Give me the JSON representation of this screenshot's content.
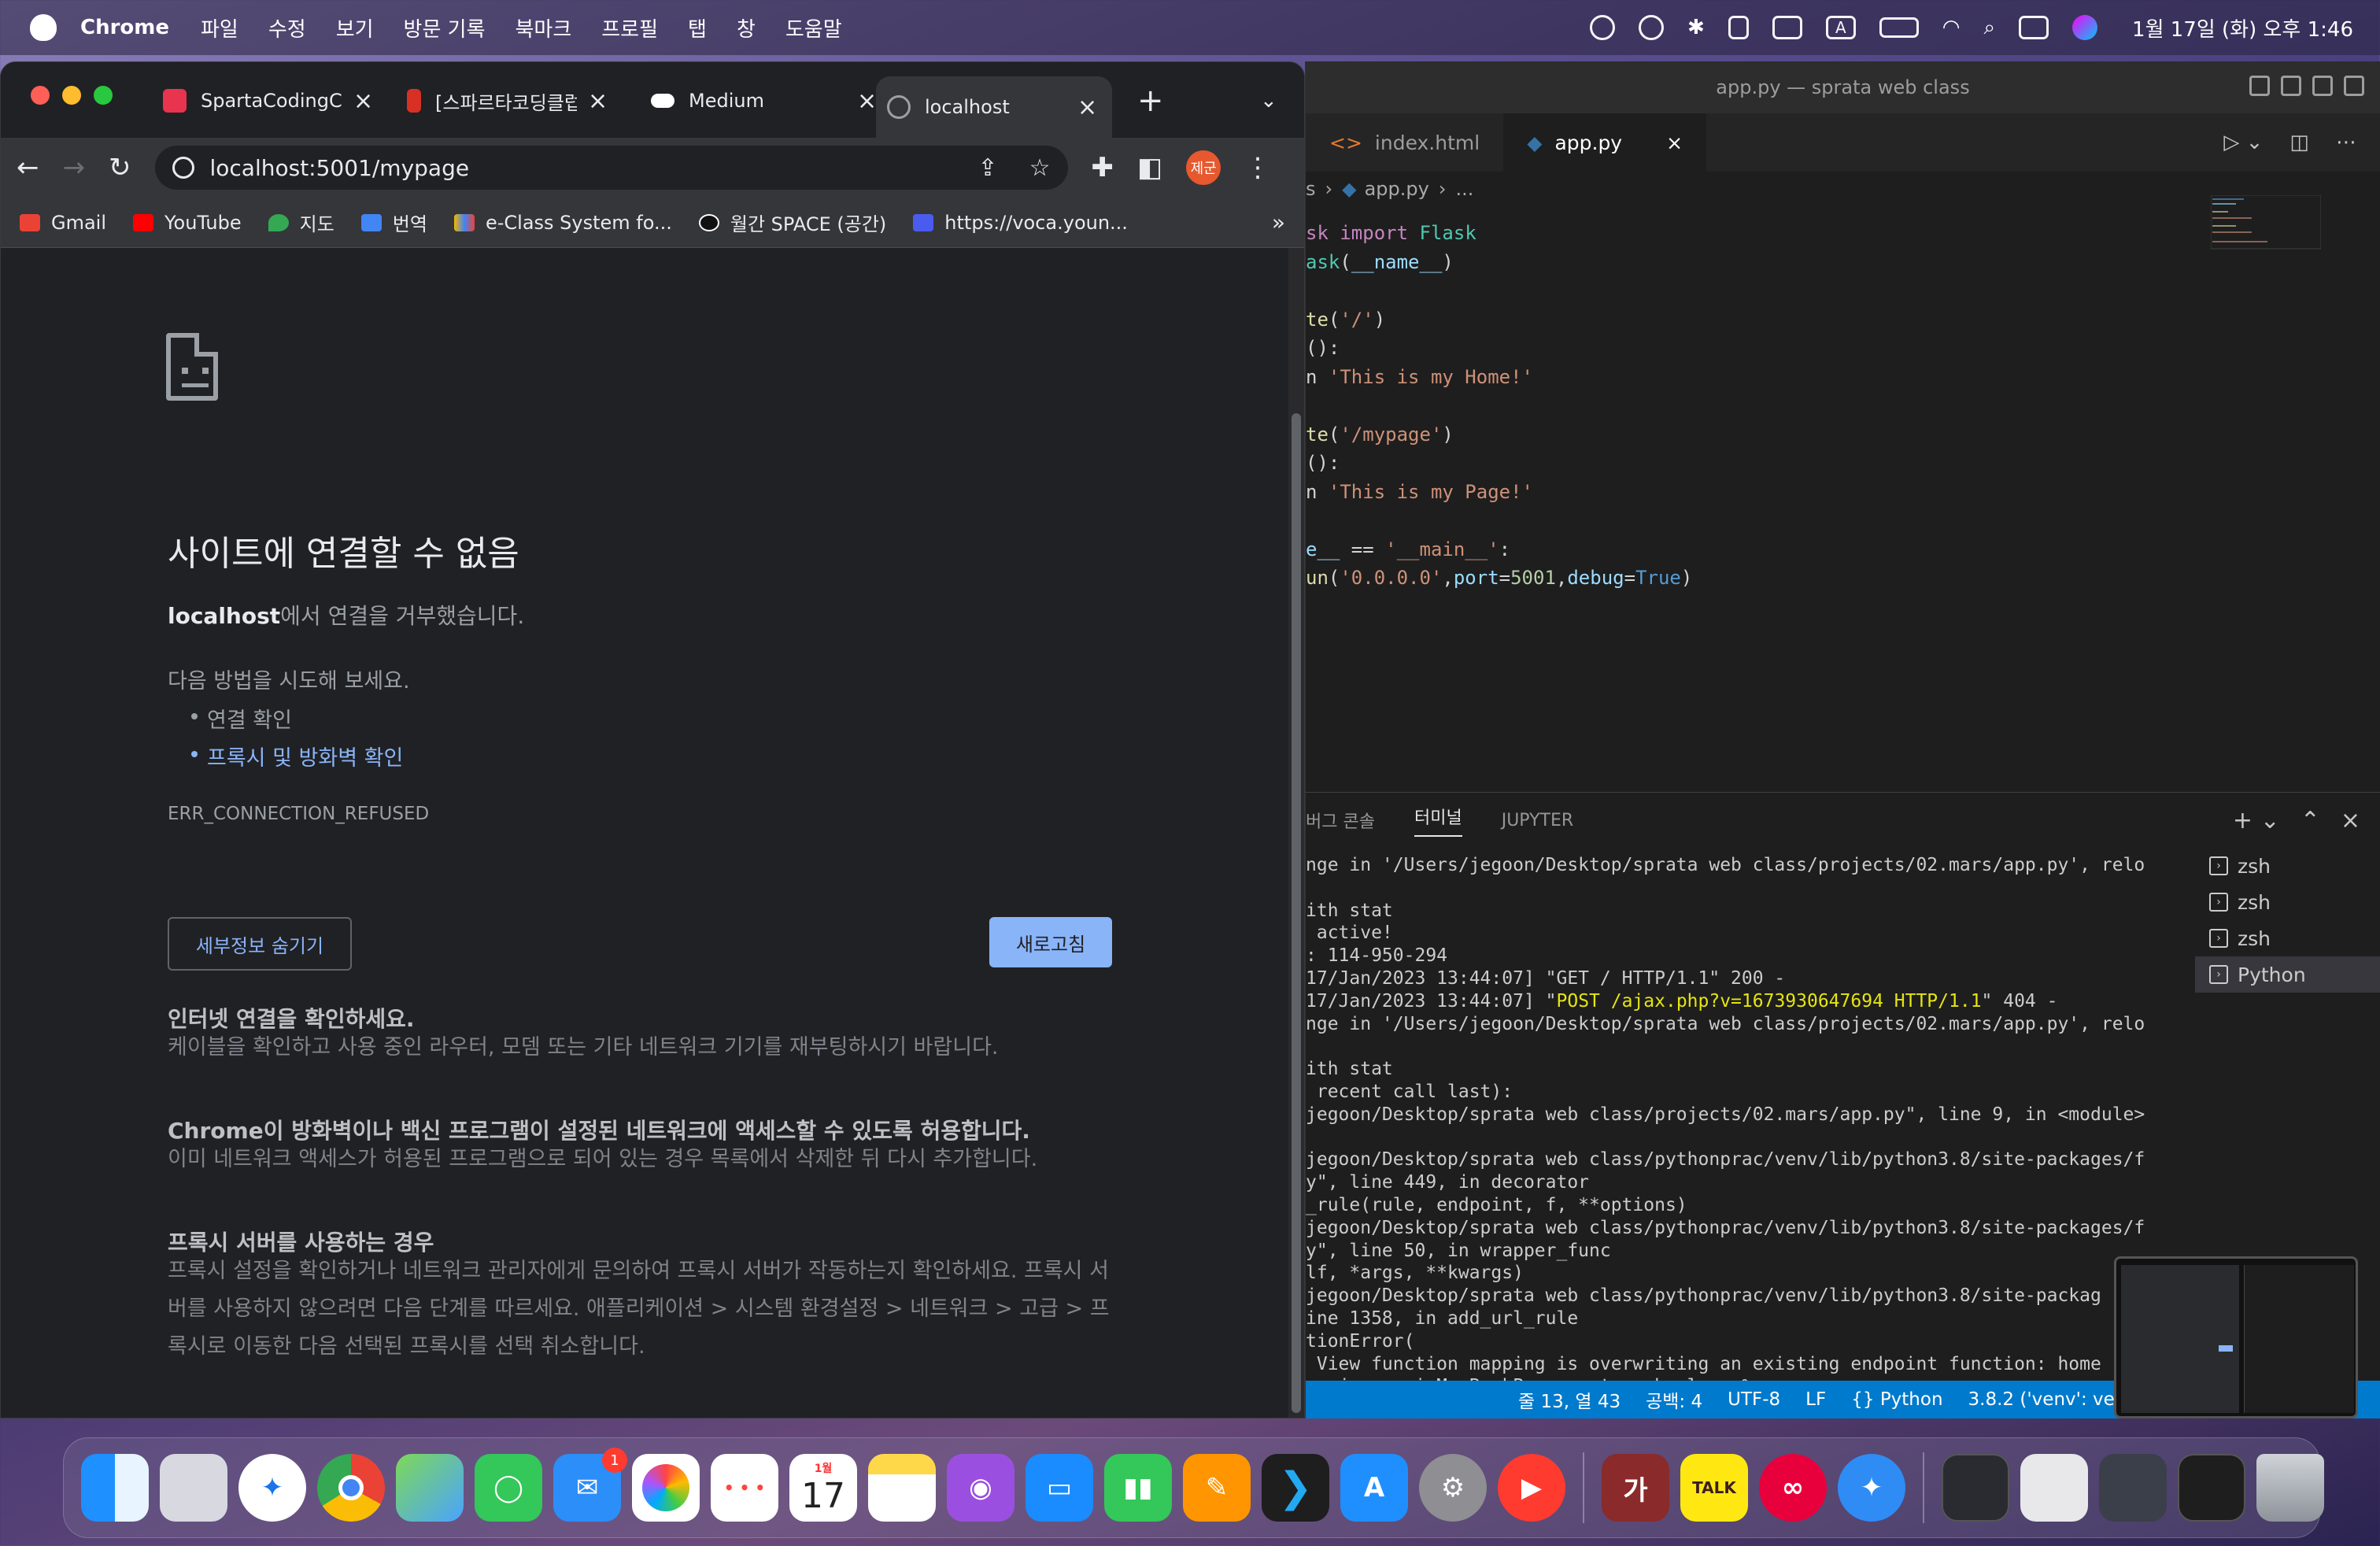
{
  "menubar": {
    "app_name": "Chrome",
    "menus": [
      "파일",
      "수정",
      "보기",
      "방문 기록",
      "북마크",
      "프로필",
      "탭",
      "창",
      "도움말"
    ],
    "clock": "1월 17일 (화) 오후 1:46",
    "status_icons": [
      "wechat-icon",
      "cloud-sync-icon",
      "bluetooth-icon",
      "id-icon",
      "display-icon",
      "input-source-icon",
      "battery-icon",
      "wifi-icon",
      "spotlight-icon",
      "control-center-icon",
      "siri-icon"
    ],
    "input_source": "A"
  },
  "chrome": {
    "tabs": [
      {
        "title": "SpartaCodingClub",
        "favicon_color": "#e8344e"
      },
      {
        "title": "[스파르타코딩클럽]",
        "favicon_color": "#d93025"
      },
      {
        "title": "Medium",
        "favicon_color": "#000000"
      },
      {
        "title": "localhost",
        "favicon_color": "#5f6368",
        "active": true
      }
    ],
    "url": "localhost:5001/mypage",
    "profile_label": "제군",
    "bookmarks": [
      "Gmail",
      "YouTube",
      "지도",
      "번역",
      "e-Class System fo...",
      "월간 SPACE (공간)",
      "https://voca.youn..."
    ],
    "error": {
      "title": "사이트에 연결할 수 없음",
      "host": "localhost",
      "desc_suffix": "에서 연결을 거부했습니다.",
      "suggest_label": "다음 방법을 시도해 보세요.",
      "suggestions": [
        "연결 확인",
        "프록시 및 방화벽 확인"
      ],
      "code": "ERR_CONNECTION_REFUSED",
      "hide_details": "세부정보 숨기기",
      "reload": "새로고침",
      "sections": [
        {
          "heading": "인터넷 연결을 확인하세요.",
          "body": "케이블을 확인하고 사용 중인 라우터, 모뎀 또는 기타 네트워크 기기를 재부팅하시기 바랍니다."
        },
        {
          "heading": "Chrome이 방화벽이나 백신 프로그램이 설정된 네트워크에 액세스할 수 있도록 허용합니다.",
          "body": "이미 네트워크 액세스가 허용된 프로그램으로 되어 있는 경우 목록에서 삭제한 뒤 다시 추가합니다."
        },
        {
          "heading": "프록시 서버를 사용하는 경우",
          "body": "프록시 설정을 확인하거나 네트워크 관리자에게 문의하여 프록시 서버가 작동하는지 확인하세요. 프록시 서버를 사용하지 않으려면 다음 단계를 따르세요. 애플리케이션 > 시스템 환경설정 > 네트워크 > 고급 > 프록시로 이동한 다음 선택된 프록시를 선택 취소합니다."
        }
      ]
    }
  },
  "vscode": {
    "title": "app.py — sprata web class",
    "tabs": [
      "index.html",
      "app.py"
    ],
    "breadcrumb": {
      "prefix": "s",
      "file": "app.py",
      "tail": "..."
    },
    "panel_tabs": [
      "버그 콘솔",
      "터미널",
      "JUPYTER"
    ],
    "terminals": [
      "zsh",
      "zsh",
      "zsh",
      "Python"
    ],
    "status": [
      "줄 13, 열 43",
      "공백: 4",
      "UTF-8",
      "LF",
      "Python",
      "3.8.2 ('venv': ve"
    ]
  },
  "dock": {
    "calendar_month": "1월",
    "calendar_day": "17",
    "mail_badge": "1",
    "hangul_app": "가",
    "talk_label": "TALK"
  }
}
